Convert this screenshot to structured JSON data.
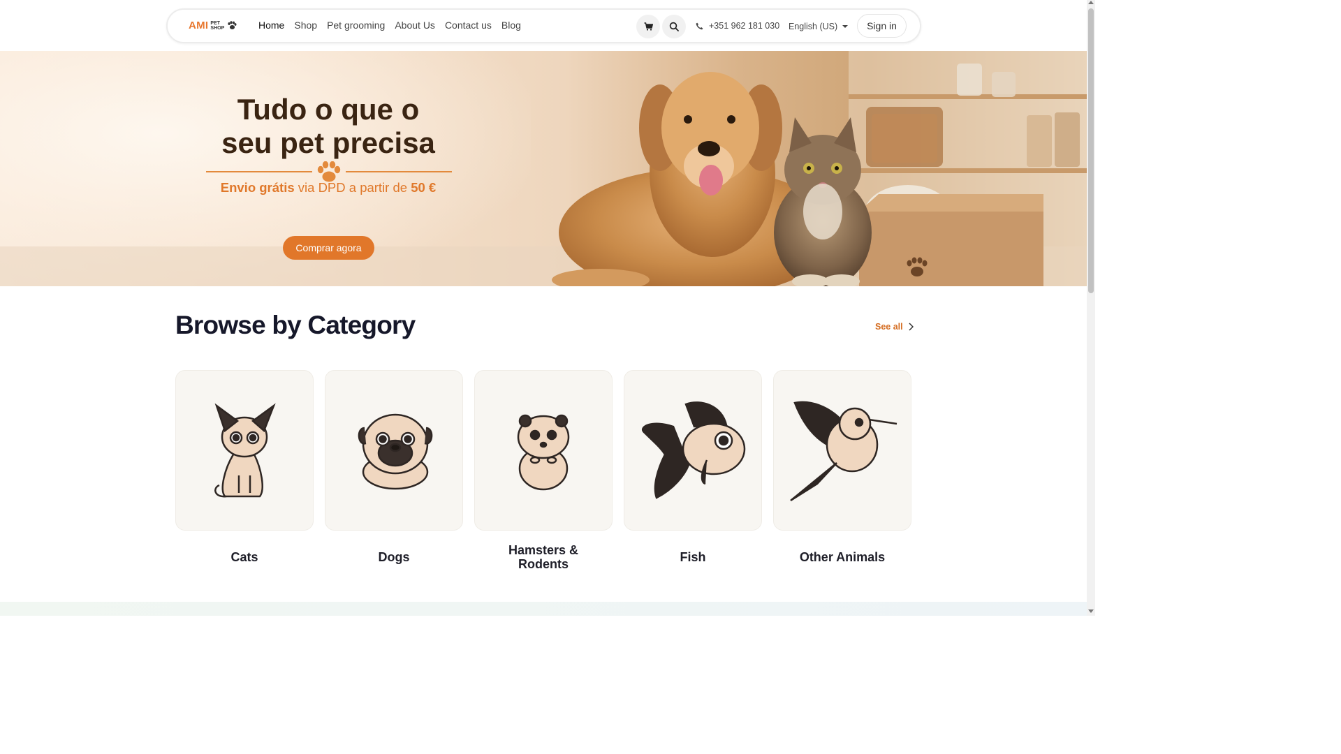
{
  "header": {
    "logo": {
      "main": "AMI",
      "sub_top": "PET",
      "sub_bottom": "SHOP"
    },
    "menu": [
      {
        "label": "Home",
        "active": true
      },
      {
        "label": "Shop",
        "active": false
      },
      {
        "label": "Pet grooming",
        "active": false
      },
      {
        "label": "About Us",
        "active": false
      },
      {
        "label": "Contact us",
        "active": false
      },
      {
        "label": "Blog",
        "active": false
      }
    ],
    "icons": {
      "cart": "cart-icon",
      "search": "search-icon",
      "phone": "phone-icon"
    },
    "phone": "+351 962 181 030",
    "language": "English (US)",
    "sign_in": "Sign in"
  },
  "hero": {
    "title_line1": "Tudo o que o",
    "title_line2": "seu pet precisa",
    "subtitle": {
      "bold1": "Envio grátis",
      "middle": " via DPD a partir de ",
      "bold2": "50 €"
    },
    "cta": "Comprar agora"
  },
  "categories": {
    "title": "Browse by Category",
    "see_all": "See all",
    "items": [
      {
        "label": "Cats",
        "icon": "cat-icon"
      },
      {
        "label": "Dogs",
        "icon": "dog-icon"
      },
      {
        "label": "Hamsters & Rodents",
        "icon": "hamster-icon"
      },
      {
        "label": "Fish",
        "icon": "fish-icon"
      },
      {
        "label": "Other Animals",
        "icon": "bird-icon"
      }
    ]
  },
  "colors": {
    "accent": "#e1772a",
    "hero_title": "#3a2412",
    "heading": "#16182a",
    "card_bg": "#f8f6f2"
  }
}
